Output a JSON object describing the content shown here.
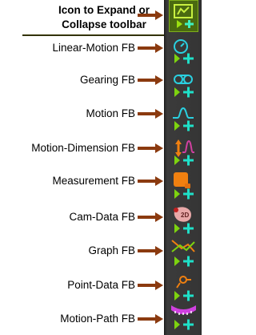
{
  "header": {
    "label": "Icon to Expand or Collapse toolbar"
  },
  "items": [
    {
      "label": "Linear-Motion FB",
      "icon": "linear-motion-icon"
    },
    {
      "label": "Gearing FB",
      "icon": "gearing-icon"
    },
    {
      "label": "Motion FB",
      "icon": "motion-icon"
    },
    {
      "label": "Motion-Dimension FB",
      "icon": "motion-dimension-icon"
    },
    {
      "label": "Measurement FB",
      "icon": "measurement-icon"
    },
    {
      "label": "Cam-Data FB",
      "icon": "cam-data-icon",
      "badge": "2D"
    },
    {
      "label": "Graph FB",
      "icon": "graph-icon"
    },
    {
      "label": "Point-Data FB",
      "icon": "point-data-icon"
    },
    {
      "label": "Motion-Path FB",
      "icon": "motion-path-icon"
    }
  ],
  "colors": {
    "arrow": "#8b3a0f",
    "play": "#7dd30f",
    "plus": "#1fe0c8",
    "cyan": "#2ad0e0",
    "orange": "#f08010",
    "magenta": "#d040e0",
    "toolbar": "#353535"
  }
}
